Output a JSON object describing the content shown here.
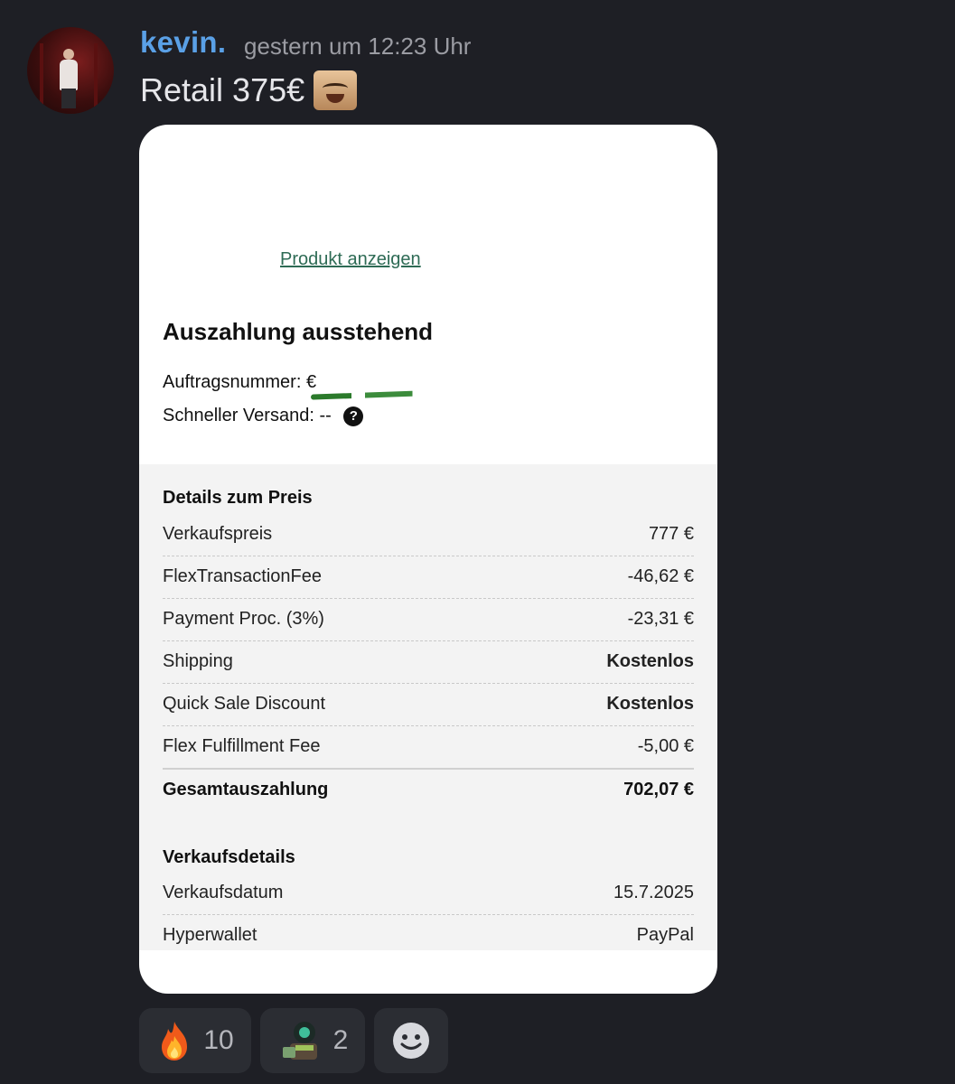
{
  "message": {
    "author": "kevin.",
    "timestamp": "gestern um 12:23 Uhr",
    "text": "Retail 375€",
    "emoji": "laughing-man-emoji"
  },
  "receipt": {
    "product_link": "Produkt anzeigen",
    "title": "Auszahlung ausstehend",
    "order_label": "Auftragsnummer:",
    "order_value": "€",
    "shipping_label": "Schneller Versand:",
    "shipping_value": "--",
    "price_section": {
      "heading": "Details zum Preis",
      "rows": [
        {
          "label": "Verkaufspreis",
          "value": "777 €"
        },
        {
          "label": "FlexTransactionFee",
          "value": "-46,62 €"
        },
        {
          "label": "Payment Proc. (3%)",
          "value": "-23,31 €"
        },
        {
          "label": "Shipping",
          "value": "Kostenlos"
        },
        {
          "label": "Quick Sale Discount",
          "value": "Kostenlos"
        },
        {
          "label": "Flex Fulfillment Fee",
          "value": "-5,00 €"
        }
      ],
      "total": {
        "label": "Gesamtauszahlung",
        "value": "702,07 €"
      }
    },
    "sale_section": {
      "heading": "Verkaufsdetails",
      "rows": [
        {
          "label": "Verkaufsdatum",
          "value": "15.7.2025"
        },
        {
          "label": "Hyperwallet",
          "value": "PayPal"
        }
      ]
    }
  },
  "reactions": [
    {
      "icon": "fire-icon",
      "count": "10"
    },
    {
      "icon": "robot-emoji-icon",
      "count": "2"
    },
    {
      "icon": "add-reaction-icon",
      "count": ""
    }
  ],
  "colors": {
    "background": "#1e1f25",
    "username": "#5aa0e6",
    "link": "#2e6b55",
    "reaction_bg": "#2b2d33"
  }
}
